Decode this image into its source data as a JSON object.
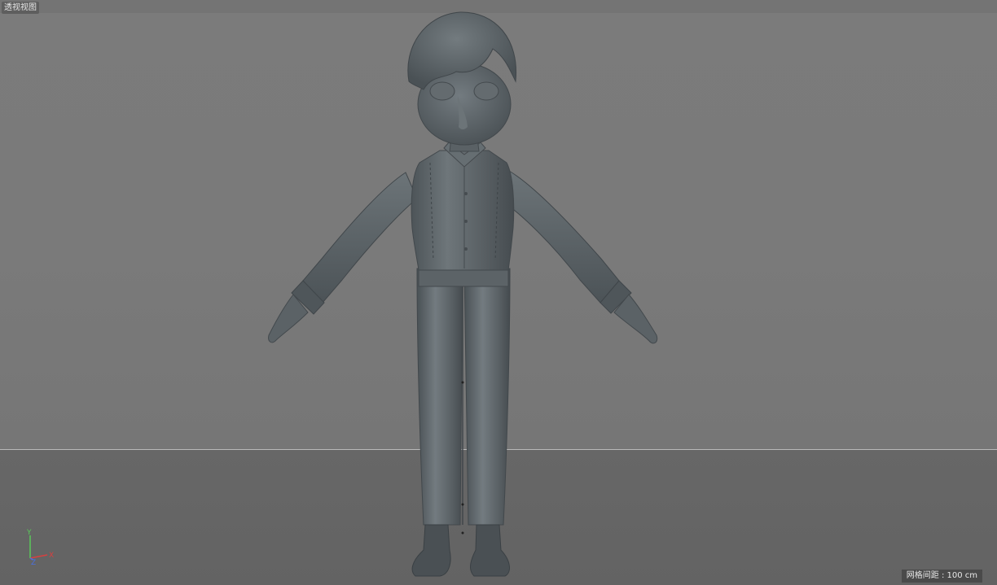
{
  "viewport": {
    "view_name": "透视视图",
    "grid_spacing_text": "网格间距 : 100 cm"
  },
  "axis_gizmo": {
    "y_label": "Y",
    "x_label": "X",
    "z_label": "Z",
    "colors": {
      "x": "#d84040",
      "y": "#5ac85a",
      "z": "#4a70e0"
    }
  },
  "scene": {
    "object": "character-model",
    "pose": "a-pose",
    "model_color": "#5d6468",
    "background_color": "#7a7a7a",
    "floor_color": "#646464"
  }
}
